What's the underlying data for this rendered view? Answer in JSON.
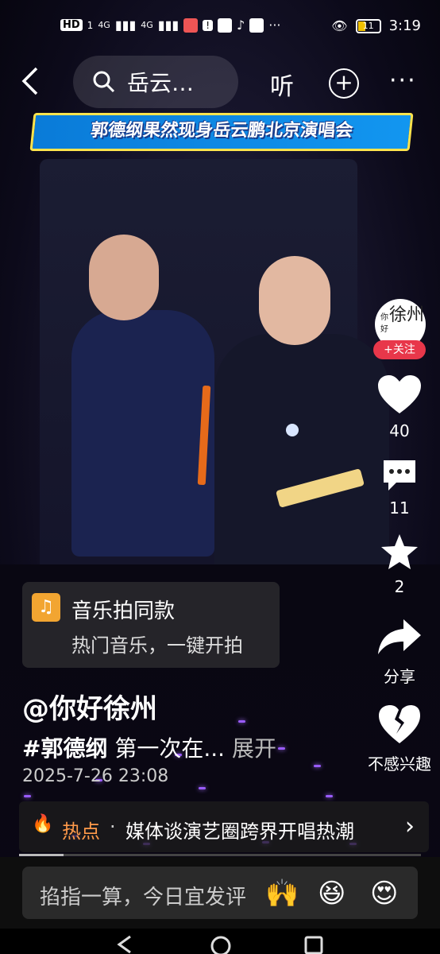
{
  "status_bar": {
    "left_badges": [
      "HD",
      "1",
      "4G",
      "4G"
    ],
    "time": "3:19",
    "battery_level": "11",
    "more_dots": "···"
  },
  "top_bar": {
    "search_text": "岳云…",
    "listen_label": "听",
    "plus_label": "+",
    "more_label": "···"
  },
  "video": {
    "banner_text": "郭德纲果然现身岳云鹏北京演唱会"
  },
  "music": {
    "title": "音乐拍同款",
    "subtitle": "热门音乐，一键开拍"
  },
  "post": {
    "author": "@你好徐州",
    "hashtag": "#郭德纲",
    "caption_rest": " 第一次在...",
    "expand_label": "展开",
    "date": "2025-7-26 23:08"
  },
  "sidebar": {
    "avatar_top": "你好",
    "avatar_big": "徐州",
    "follow_label": "+关注",
    "like_count": "40",
    "comment_count": "11",
    "favorite_count": "2",
    "share_label": "分享",
    "dislike_label": "不感兴趣"
  },
  "hot_topic": {
    "tag": "热点",
    "separator": "·",
    "text": "媒体谈演艺圈跨界开唱热潮",
    "chevron": "›"
  },
  "progress": {
    "fraction": 0.11
  },
  "comment_bar": {
    "placeholder": "掐指一算，今日宜发评",
    "emojis": [
      "🙌",
      "😆",
      "😍"
    ]
  },
  "colors": {
    "accent_red": "#e8374a",
    "hot_orange": "#ff9a4a",
    "banner_blue": "#0a7bd8",
    "banner_yellow": "#ffe44d"
  }
}
